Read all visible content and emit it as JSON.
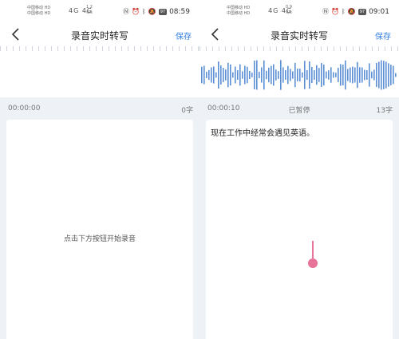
{
  "colors": {
    "accent": "#2f7de1",
    "wave": "#5b8fd6",
    "cursor": "#e8749a"
  },
  "left": {
    "status": {
      "carrier1": "中国移动 HD",
      "carrier2": "中国移动 HD",
      "net": "4G 4G",
      "speed_value": "1.2",
      "speed_unit": "K/s",
      "battery": "97",
      "time": "08:59"
    },
    "header": {
      "title": "录音实时转写",
      "save": "保存"
    },
    "info": {
      "time": "00:00:00",
      "status": "",
      "count": "0字"
    },
    "card": {
      "hint": "点击下方按钮开始录音"
    }
  },
  "right": {
    "status": {
      "carrier1": "中国移动 HD",
      "carrier2": "中国移动 HD",
      "net": "4G 4G",
      "speed_value": "0.9",
      "speed_unit": "K/s",
      "battery": "97",
      "time": "09:01"
    },
    "header": {
      "title": "录音实时转写",
      "save": "保存"
    },
    "info": {
      "time": "00:00:10",
      "status": "已暂停",
      "count": "13字"
    },
    "card": {
      "text": "现在工作中经常会遇见英语。"
    }
  }
}
